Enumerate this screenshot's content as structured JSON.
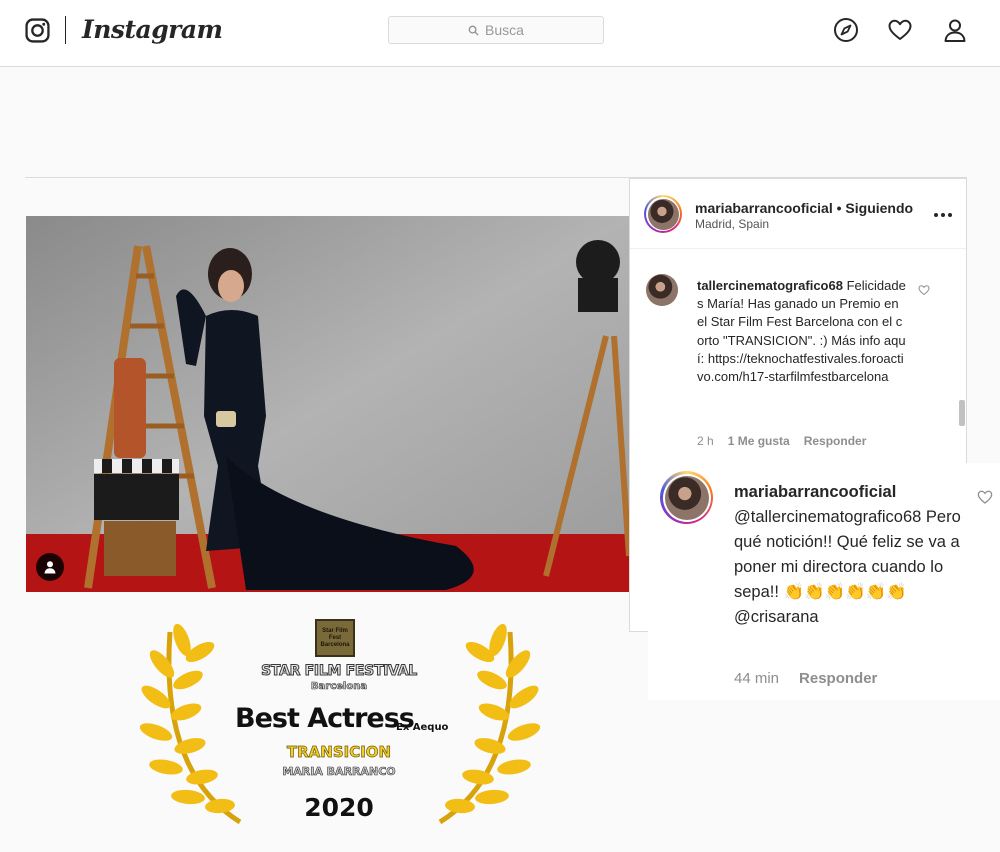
{
  "header": {
    "brand": "Instagram",
    "search_placeholder": "Busca",
    "icons": [
      "instagram-glyph",
      "search-icon",
      "compass-icon",
      "heart-icon",
      "profile-icon"
    ]
  },
  "post": {
    "username": "mariabarrancooficial",
    "separator": "•",
    "follow_status": "Siguiendo",
    "location": "Madrid, Spain",
    "comments": [
      {
        "username": "tallercinematografico68",
        "text": " Felicidades María! Has ganado un Premio en el Star Film Fest Barcelona con el corto \"TRANSICION\". :) Más info aquí: https://teknochatfestivales.foroactivo.com/h17-starfilmfestbarcelona",
        "time": "2 h",
        "likes": "1 Me gusta",
        "reply_label": "Responder"
      }
    ]
  },
  "zoom_reply": {
    "username": "mariabarrancooficial",
    "text": " @tallercinematografico68 Pero qué notición!! Qué feliz se va a poner mi directora cuando lo sepa!! 👏👏👏👏👏👏 @crisarana",
    "time": "44 min",
    "reply_label": "Responder"
  },
  "award": {
    "logo_text": "Star Film Fest Barcelona",
    "festival": "STAR FILM FESTIVAL",
    "city": "Barcelona",
    "title": "Best Actress",
    "ex_aequo": "Ex Aequo",
    "film": "TRANSICION",
    "name": "MARIA BARRANCO",
    "year": "2020"
  },
  "colors": {
    "award_gold": "#f2cf2b",
    "link_text": "#262626",
    "muted_text": "#8e8e8e",
    "border": "#dbdbdb"
  }
}
